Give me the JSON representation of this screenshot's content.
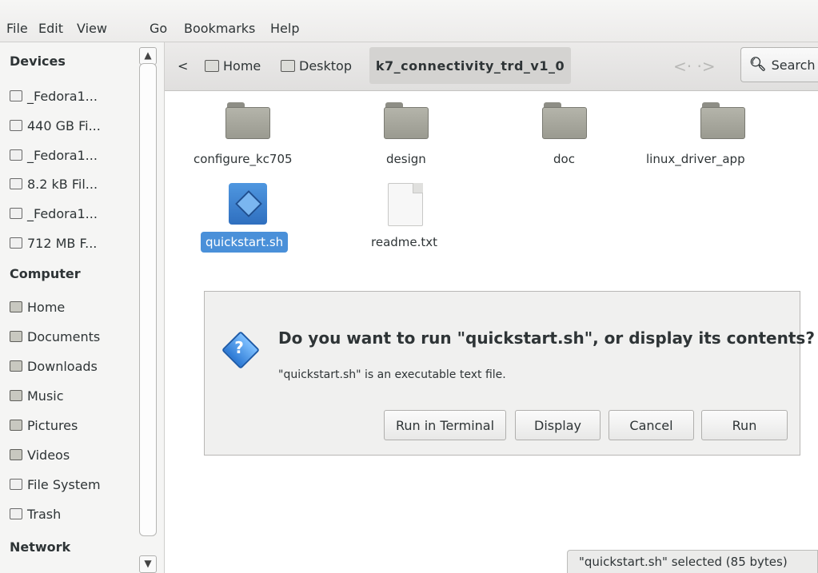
{
  "menubar": {
    "items": [
      "File",
      "Edit",
      "View",
      "Go",
      "Bookmarks",
      "Help"
    ]
  },
  "sidebar": {
    "devices_header": "Devices",
    "devices": [
      "_Fedora1...",
      "440 GB Fi...",
      "_Fedora1...",
      "8.2 kB Fil...",
      "_Fedora1...",
      "712 MB F..."
    ],
    "computer_header": "Computer",
    "places": [
      "Home",
      "Documents",
      "Downloads",
      "Music",
      "Pictures",
      "Videos",
      "File System",
      "Trash"
    ],
    "network_header": "Network"
  },
  "toolbar": {
    "back_glyph": "<",
    "crumbs": [
      "Home",
      "Desktop"
    ],
    "active_crumb": "k7_connectivity_trd_v1_0",
    "nav_arrows": "<· ·>",
    "search_label": "Search"
  },
  "files": {
    "folders": [
      "configure_kc705",
      "design",
      "doc",
      "linux_driver_app"
    ],
    "script": "quickstart.sh",
    "text": "readme.txt"
  },
  "dialog": {
    "icon_glyph": "?",
    "title": "Do you want to run \"quickstart.sh\", or display its contents?",
    "subtitle": "\"quickstart.sh\" is an executable text file.",
    "buttons": [
      "Run in Terminal",
      "Display",
      "Cancel",
      "Run"
    ]
  },
  "status": {
    "text": "\"quickstart.sh\" selected (85 bytes)"
  }
}
